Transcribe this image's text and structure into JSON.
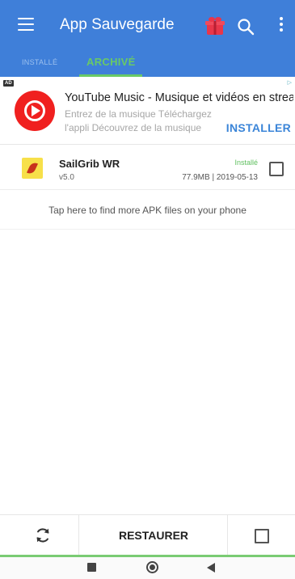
{
  "appbar": {
    "title": "App Sauvegarde",
    "icons": [
      "menu-icon",
      "gift-icon",
      "search-icon",
      "more-vert-icon"
    ]
  },
  "tabs": [
    {
      "label": "INSTALLÉ",
      "active": false
    },
    {
      "label": "ARCHIVÉ",
      "active": true
    }
  ],
  "ad": {
    "badge": "AD",
    "title": "YouTube Music - Musique et vidéos en streaming",
    "description": "Entrez de la musique Téléchargez l'appli Découvrez de la musique",
    "cta": "INSTALLER",
    "icon": "youtube-music-icon"
  },
  "apps": [
    {
      "name": "SailGrib WR",
      "version": "v5.0",
      "status": "Installé",
      "meta": "77.9MB | 2019-05-13",
      "checked": false
    }
  ],
  "hint": "Tap here to find more APK files on your phone",
  "bottombar": {
    "restore_label": "RESTAURER"
  },
  "colors": {
    "primary": "#3f7fd9",
    "accent_green": "#69c967",
    "link_blue": "#3b85d8"
  }
}
